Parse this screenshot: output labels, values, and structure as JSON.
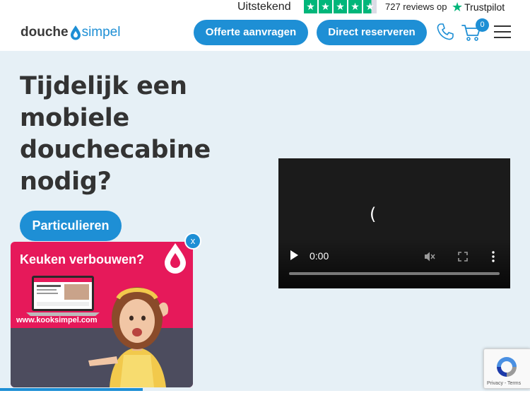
{
  "trustpilot": {
    "rating_text": "Uitstekend",
    "stars": 4.5,
    "reviews_text": "727 reviews op",
    "brand": "Trustpilot",
    "star_color": "#00b67a"
  },
  "header": {
    "logo_part1": "douche",
    "logo_part2": "simpel",
    "offerte_label": "Offerte aanvragen",
    "reserveren_label": "Direct reserveren",
    "cart_count": "0",
    "accent_color": "#1e8fd5",
    "icons": [
      "phone-icon",
      "cart-icon",
      "hamburger-menu-icon"
    ]
  },
  "hero": {
    "title": "Tijdelijk een mobiele douchecabine nodig?",
    "particulieren_label": "Particulieren"
  },
  "video": {
    "loading_glyph": "(",
    "time": "0:00",
    "progress": 0,
    "icons": [
      "play-icon",
      "mute-icon",
      "fullscreen-icon",
      "more-options-icon"
    ]
  },
  "promo": {
    "close_label": "x",
    "title": "Keuken verbouwen?",
    "url": "www.kooksimpel.com",
    "background_color": "#e6195a"
  },
  "recaptcha": {
    "footer": "Privacy - Terms"
  }
}
